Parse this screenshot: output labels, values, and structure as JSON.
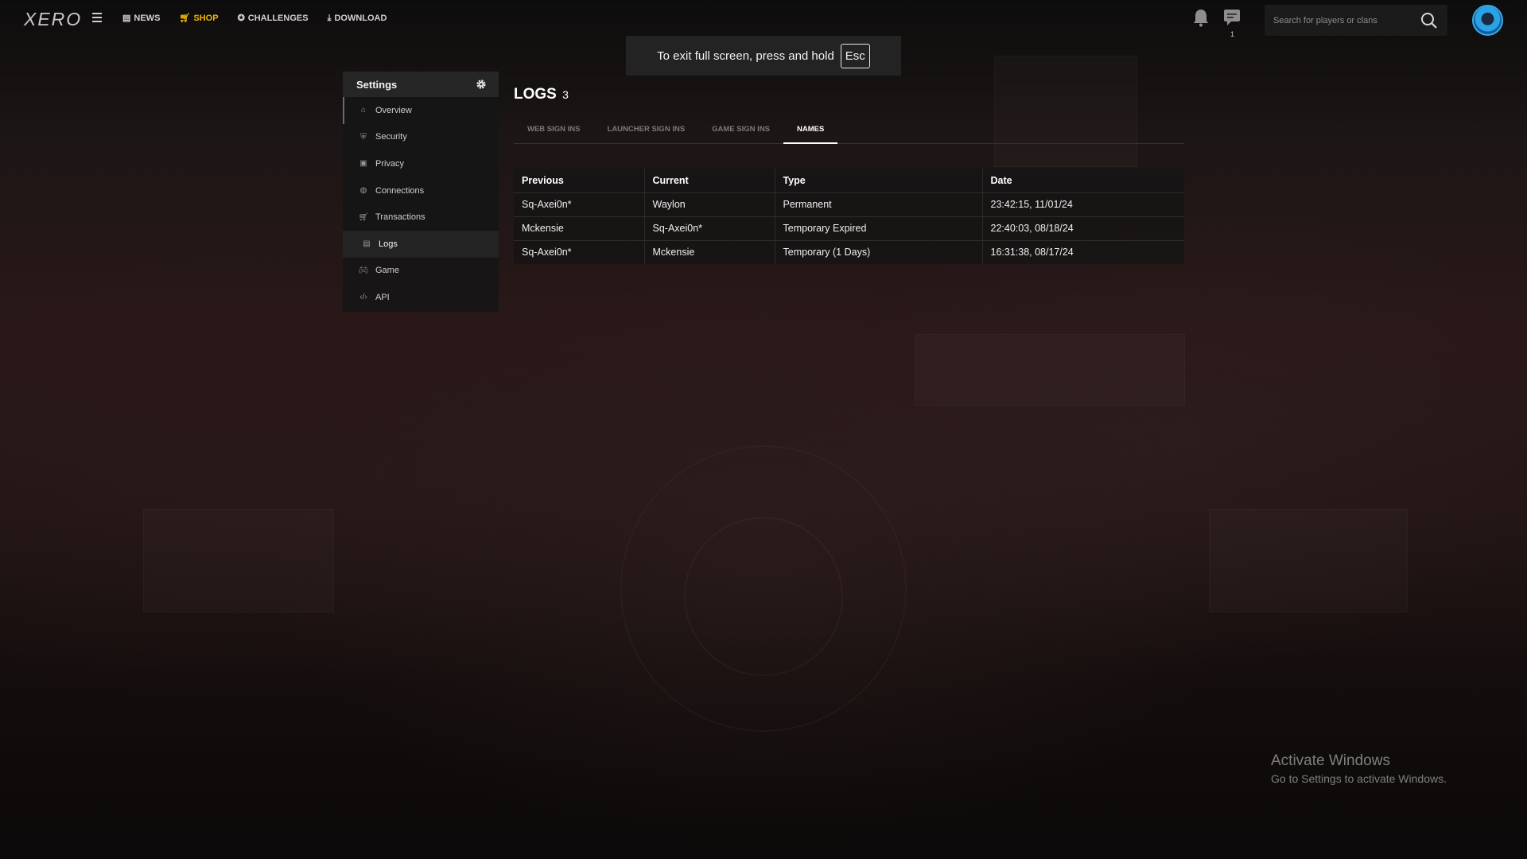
{
  "header": {
    "logo_text": "XERO",
    "nav": [
      {
        "label": "NEWS",
        "icon": "newspaper-icon"
      },
      {
        "label": "SHOP",
        "icon": "cart-icon",
        "active": true
      },
      {
        "label": "CHALLENGES",
        "icon": "medal-icon"
      },
      {
        "label": "DOWNLOAD",
        "icon": "download-icon"
      }
    ],
    "messages_count": "1",
    "search_placeholder": "Search for players or clans"
  },
  "fullscreen_notice": {
    "text": "To exit full screen, press and hold",
    "key": "Esc"
  },
  "sidebar": {
    "title": "Settings",
    "items": [
      {
        "label": "Overview",
        "icon": "home-icon"
      },
      {
        "label": "Security",
        "icon": "shield-icon"
      },
      {
        "label": "Privacy",
        "icon": "lock-icon"
      },
      {
        "label": "Connections",
        "icon": "globe-icon"
      },
      {
        "label": "Transactions",
        "icon": "cart-icon"
      },
      {
        "label": "Logs",
        "icon": "document-icon",
        "active": true
      },
      {
        "label": "Game",
        "icon": "gamepad-icon"
      },
      {
        "label": "API",
        "icon": "code-icon"
      }
    ]
  },
  "main": {
    "title": "LOGS",
    "count": "3",
    "tabs": [
      {
        "label": "WEB SIGN INS"
      },
      {
        "label": "LAUNCHER SIGN INS"
      },
      {
        "label": "GAME SIGN INS"
      },
      {
        "label": "NAMES",
        "active": true
      }
    ],
    "table": {
      "columns": [
        "Previous",
        "Current",
        "Type",
        "Date"
      ],
      "rows": [
        [
          "Sq-Axei0n*",
          "Waylon",
          "Permanent",
          "23:42:15, 11/01/24"
        ],
        [
          "Mckensie",
          "Sq-Axei0n*",
          "Temporary Expired",
          "22:40:03, 08/18/24"
        ],
        [
          "Sq-Axei0n*",
          "Mckensie",
          "Temporary (1 Days)",
          "16:31:38, 08/17/24"
        ]
      ]
    }
  },
  "watermark": {
    "title": "Activate Windows",
    "subtitle": "Go to Settings to activate Windows."
  },
  "colors": {
    "accent": "#f0b400",
    "background": "#1d1616"
  }
}
